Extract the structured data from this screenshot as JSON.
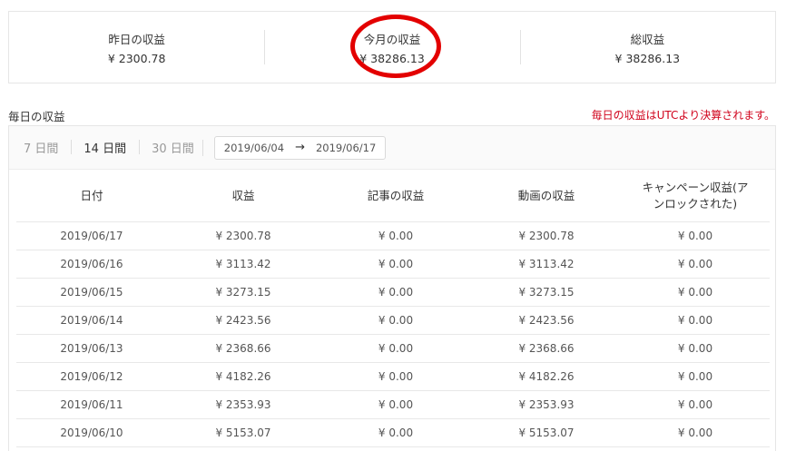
{
  "summary": {
    "yesterday": {
      "label": "昨日の収益",
      "value": "¥ 2300.78"
    },
    "this_month": {
      "label": "今月の収益",
      "value": "¥ 38286.13"
    },
    "total": {
      "label": "総収益",
      "value": "¥ 38286.13"
    }
  },
  "section": {
    "title": "毎日の収益",
    "note": "毎日の収益はUTCより決算されます。"
  },
  "range_tabs": [
    {
      "label": "7 日間",
      "active": false
    },
    {
      "label": "14 日間",
      "active": true
    },
    {
      "label": "30 日間",
      "active": false
    }
  ],
  "date_range": {
    "start": "2019/06/04",
    "end": "2019/06/17"
  },
  "table": {
    "headers": [
      "日付",
      "収益",
      "記事の収益",
      "動画の収益",
      "キャンペーン収益(アンロックされた)"
    ],
    "rows": [
      [
        "2019/06/17",
        "¥ 2300.78",
        "¥ 0.00",
        "¥ 2300.78",
        "¥ 0.00"
      ],
      [
        "2019/06/16",
        "¥ 3113.42",
        "¥ 0.00",
        "¥ 3113.42",
        "¥ 0.00"
      ],
      [
        "2019/06/15",
        "¥ 3273.15",
        "¥ 0.00",
        "¥ 3273.15",
        "¥ 0.00"
      ],
      [
        "2019/06/14",
        "¥ 2423.56",
        "¥ 0.00",
        "¥ 2423.56",
        "¥ 0.00"
      ],
      [
        "2019/06/13",
        "¥ 2368.66",
        "¥ 0.00",
        "¥ 2368.66",
        "¥ 0.00"
      ],
      [
        "2019/06/12",
        "¥ 4182.26",
        "¥ 0.00",
        "¥ 4182.26",
        "¥ 0.00"
      ],
      [
        "2019/06/11",
        "¥ 2353.93",
        "¥ 0.00",
        "¥ 2353.93",
        "¥ 0.00"
      ],
      [
        "2019/06/10",
        "¥ 5153.07",
        "¥ 0.00",
        "¥ 5153.07",
        "¥ 0.00"
      ]
    ]
  },
  "colors": {
    "highlight": "#e30000",
    "note": "#d0021b"
  }
}
